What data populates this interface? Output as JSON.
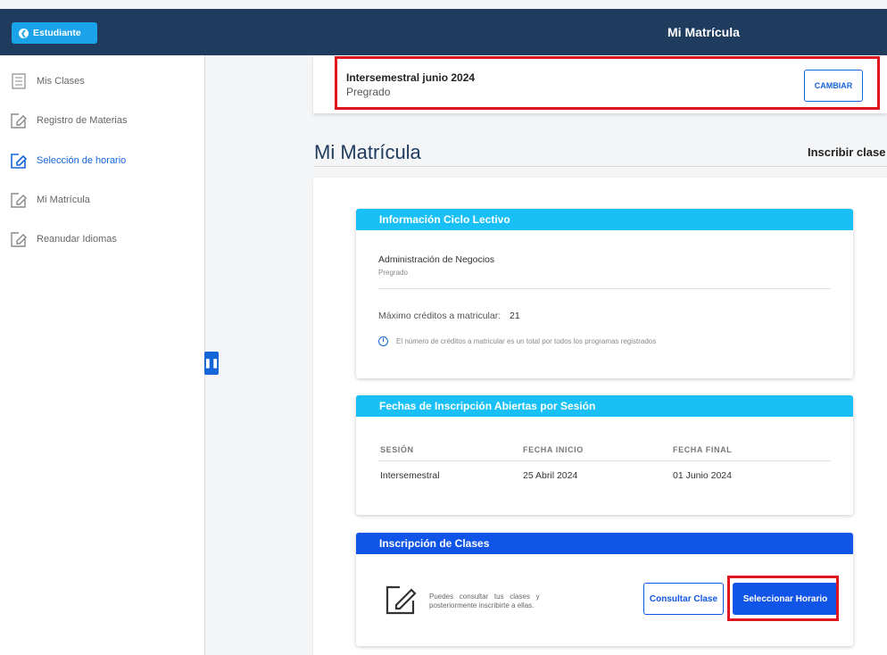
{
  "topbar": {
    "back_label": "Estudiante",
    "title": "Mi Matrícula"
  },
  "sidebar": {
    "items": [
      {
        "label": "Mis Clases",
        "icon": "class-list-icon",
        "active": false
      },
      {
        "label": "Registro de Materias",
        "icon": "edit-icon",
        "active": false
      },
      {
        "label": "Selección de horario",
        "icon": "edit-icon",
        "active": true
      },
      {
        "label": "Mi Matrícula",
        "icon": "edit-icon",
        "active": false
      },
      {
        "label": "Reanudar Idiomas",
        "icon": "edit-icon",
        "active": false
      }
    ]
  },
  "period": {
    "name": "Intersemestral junio 2024",
    "level": "Pregrado",
    "change_label": "CAMBIAR"
  },
  "main": {
    "heading": "Mi Matrícula",
    "link": "Inscribir clase"
  },
  "ciclo": {
    "title": "Información Ciclo Lectivo",
    "program": "Administración de Negocios",
    "program_level": "Pregrado",
    "max_credits_label": "Máximo créditos a matricular:",
    "max_credits_value": "21",
    "note": "El número de créditos a matricular es un total por todos los programas registrados"
  },
  "fechas": {
    "title": "Fechas de Inscripción Abiertas por Sesión",
    "columns": [
      "SESIÓN",
      "FECHA INICIO",
      "FECHA FINAL"
    ],
    "rows": [
      [
        "Intersemestral",
        "25 Abril 2024",
        "01 Junio 2024"
      ]
    ]
  },
  "inscripcion": {
    "title": "Inscripción de Clases",
    "text_line1": "Puedes   consultar   tus   clases   y",
    "text_line2": "posteriormente inscribirte a ellas.",
    "consult_label": "Consultar Clase",
    "select_label": "Seleccionar Horario"
  },
  "colors": {
    "navy": "#1f3b5e",
    "accent_blue": "#1155e8",
    "cyan": "#18c0f5",
    "highlight_red": "#e0161e"
  }
}
